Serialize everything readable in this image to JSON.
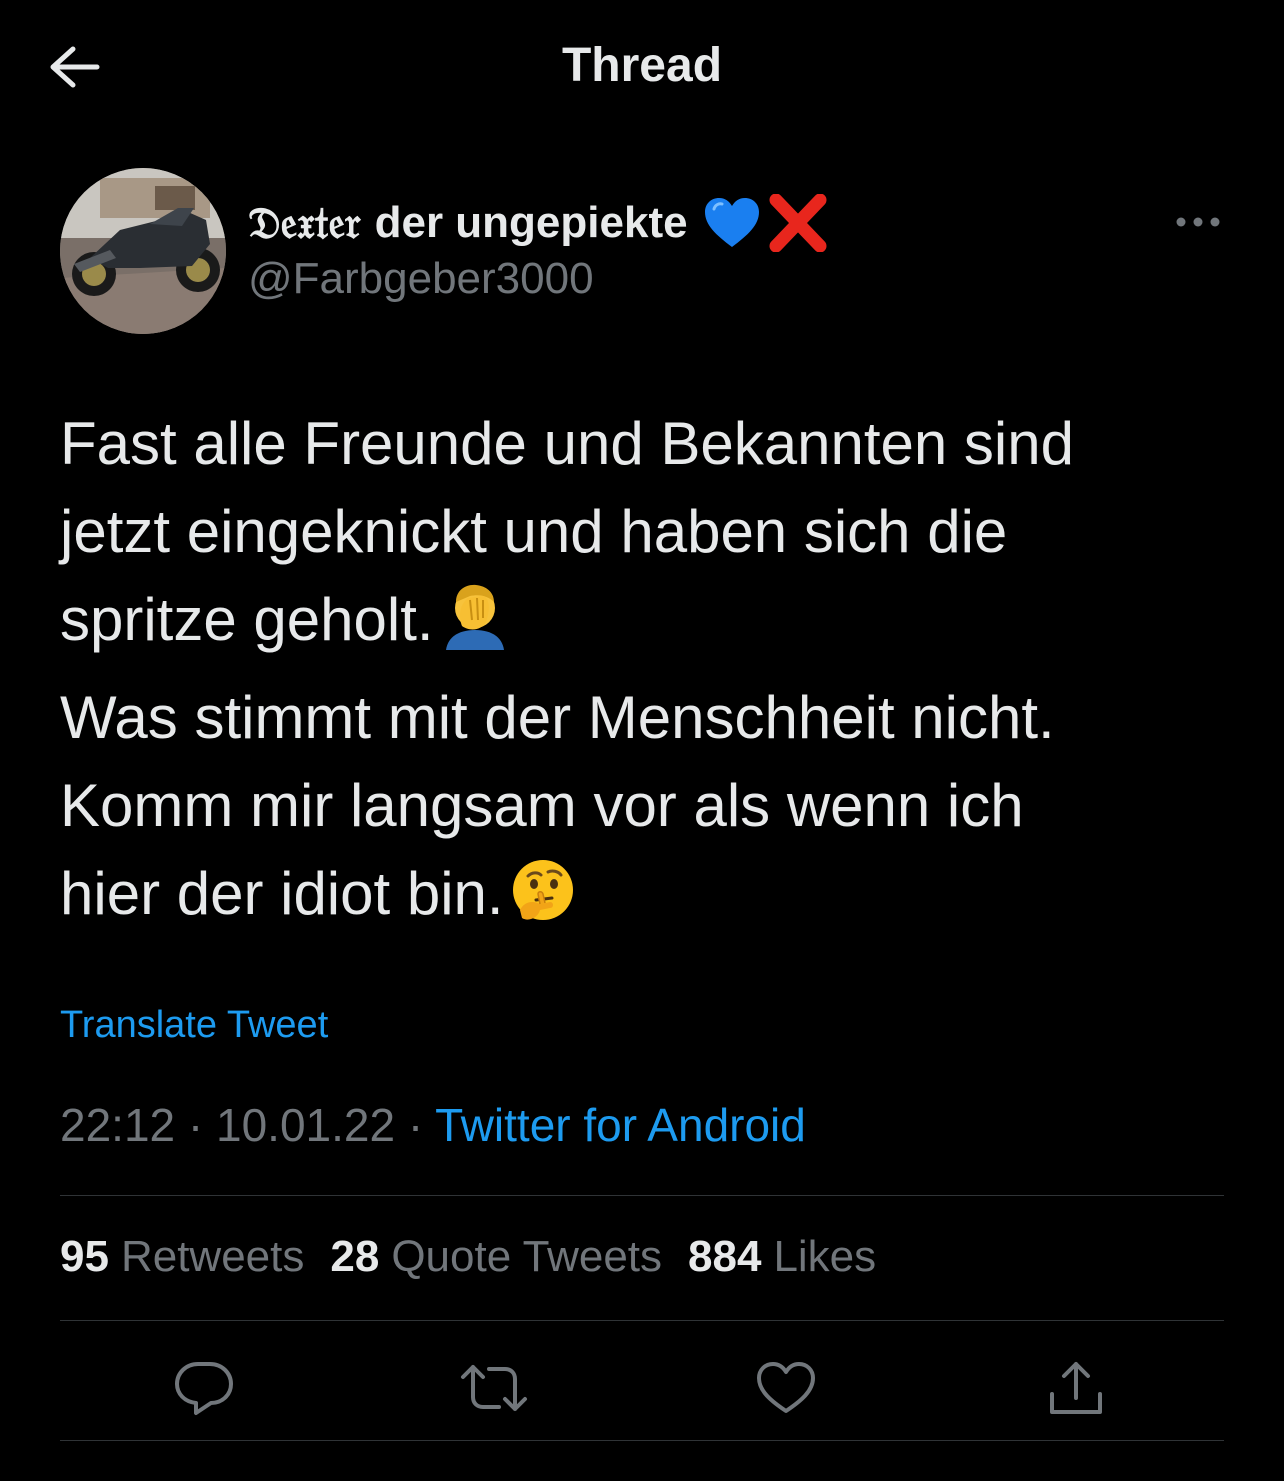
{
  "header": {
    "title": "Thread",
    "back_icon": "arrow-left-icon"
  },
  "author": {
    "display_name_gothic": "𝔇𝔢𝔵𝔱𝔢𝔯",
    "display_name_rest": "der ungepiekte",
    "name_emojis": [
      "blue-heart-icon",
      "cross-mark-icon"
    ],
    "handle": "@Farbgeber3000",
    "avatar": "motorcycle-avatar"
  },
  "tweet": {
    "lines": [
      "Fast alle Freunde und Bekannten sind",
      "jetzt eingeknickt und haben sich die",
      "spritze geholt.",
      "Was stimmt mit der Menschheit nicht.",
      "Komm mir langsam vor als wenn ich",
      "hier der idiot bin."
    ],
    "translate_label": "Translate Tweet",
    "time": "22:12",
    "date": "10.01.22",
    "separator": "·",
    "source": "Twitter for Android"
  },
  "stats": {
    "retweets_count": "95",
    "retweets_label": "Retweets",
    "quotes_count": "28",
    "quotes_label": "Quote Tweets",
    "likes_count": "884",
    "likes_label": "Likes"
  },
  "actions": [
    "reply-icon",
    "retweet-icon",
    "like-icon",
    "share-icon"
  ],
  "colors": {
    "background": "#000000",
    "text": "#e7e9ea",
    "secondary": "#71767b",
    "accent": "#1d9bf0",
    "divider": "#2f3336"
  }
}
